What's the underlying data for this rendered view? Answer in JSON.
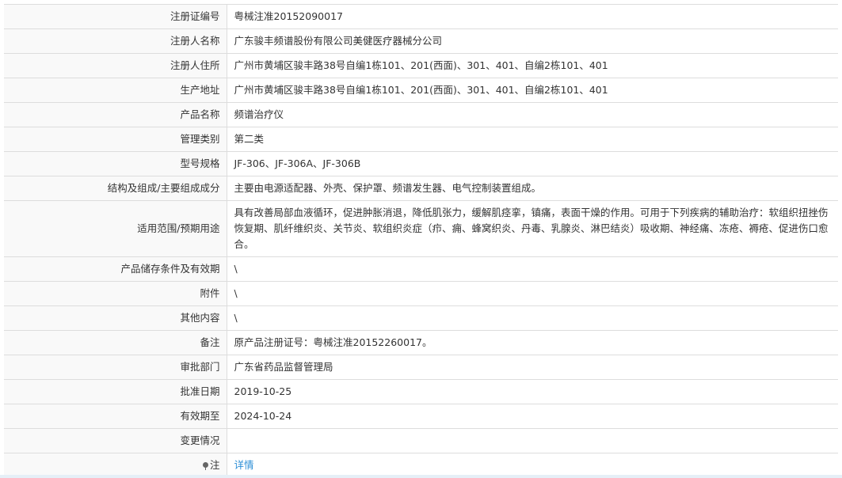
{
  "rows": [
    {
      "label": "注册证编号",
      "value": "粤械注准20152090017"
    },
    {
      "label": "注册人名称",
      "value": "广东骏丰频谱股份有限公司美健医疗器械分公司"
    },
    {
      "label": "注册人住所",
      "value": "广州市黄埔区骏丰路38号自编1栋101、201(西面)、301、401、自编2栋101、401"
    },
    {
      "label": "生产地址",
      "value": "广州市黄埔区骏丰路38号自编1栋101、201(西面)、301、401、自编2栋101、401"
    },
    {
      "label": "产品名称",
      "value": "频谱治疗仪"
    },
    {
      "label": "管理类别",
      "value": "第二类"
    },
    {
      "label": "型号规格",
      "value": "JF-306、JF-306A、JF-306B"
    },
    {
      "label": "结构及组成/主要组成成分",
      "value": "主要由电源适配器、外壳、保护罩、频谱发生器、电气控制装置组成。"
    },
    {
      "label": "适用范围/预期用途",
      "value": "具有改善局部血液循环，促进肿胀消退，降低肌张力，缓解肌痉挛，镇痛，表面干燥的作用。可用于下列疾病的辅助治疗：软组织扭挫伤恢复期、肌纤维织炎、关节炎、软组织炎症（疖、痈、蜂窝织炎、丹毒、乳腺炎、淋巴结炎）吸收期、神经痛、冻疮、褥疮、促进伤口愈合。"
    },
    {
      "label": "产品储存条件及有效期",
      "value": "\\"
    },
    {
      "label": "附件",
      "value": "\\"
    },
    {
      "label": "其他内容",
      "value": "\\"
    },
    {
      "label": "备注",
      "value": "原产品注册证号：粤械注准20152260017。"
    },
    {
      "label": "审批部门",
      "value": "广东省药品监督管理局"
    },
    {
      "label": "批准日期",
      "value": "2019-10-25"
    },
    {
      "label": "有效期至",
      "value": "2024-10-24"
    },
    {
      "label": "变更情况",
      "value": ""
    }
  ],
  "note_row": {
    "label": "注",
    "link_text": "详情"
  },
  "icons": {
    "note": "location-pin-icon"
  },
  "colors": {
    "link": "#2b8ed6",
    "label_bg": "#f9f9f9",
    "border": "#dddddd"
  }
}
